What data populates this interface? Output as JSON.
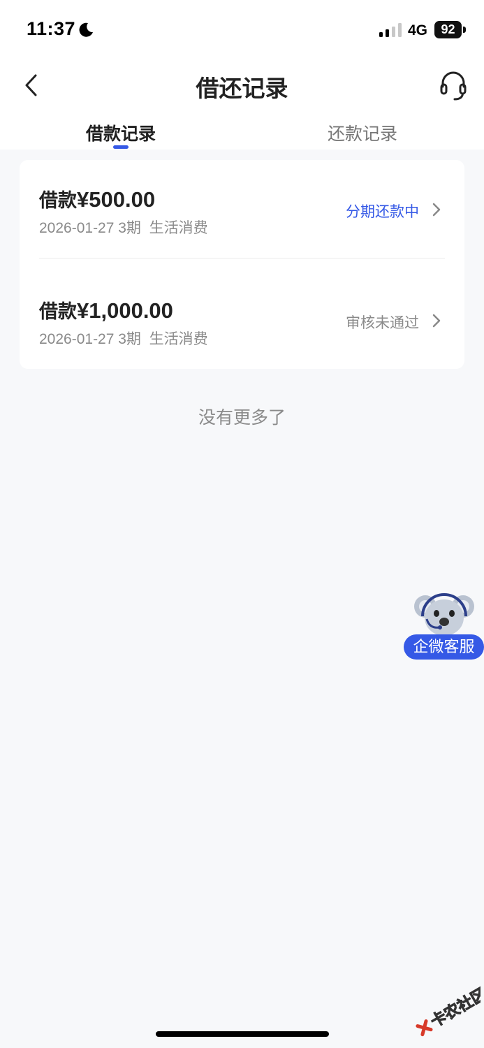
{
  "status_bar": {
    "time": "11:37",
    "network": "4G",
    "battery": "92"
  },
  "nav": {
    "title": "借还记录"
  },
  "tabs": [
    {
      "label": "借款记录",
      "active": true
    },
    {
      "label": "还款记录",
      "active": false
    }
  ],
  "records": [
    {
      "prefix": "借款",
      "amount": "¥500.00",
      "date": "2026-01-27",
      "terms": "3期",
      "purpose": "生活消费",
      "status": "分期还款中",
      "meta": "2026-01-27 3期  生活消费"
    },
    {
      "prefix": "借款",
      "amount": "¥1,000.00",
      "date": "2026-01-27",
      "terms": "3期",
      "purpose": "生活消费",
      "status": "审核未通过",
      "meta": "2026-01-27 3期  生活消费"
    }
  ],
  "footer": {
    "no_more": "没有更多了"
  },
  "floating_service": {
    "label": "企微客服"
  },
  "watermark": {
    "text": "卡农社区"
  },
  "colors": {
    "accent": "#3559e6",
    "muted": "#8a8a8a",
    "background": "#f7f8fa"
  }
}
